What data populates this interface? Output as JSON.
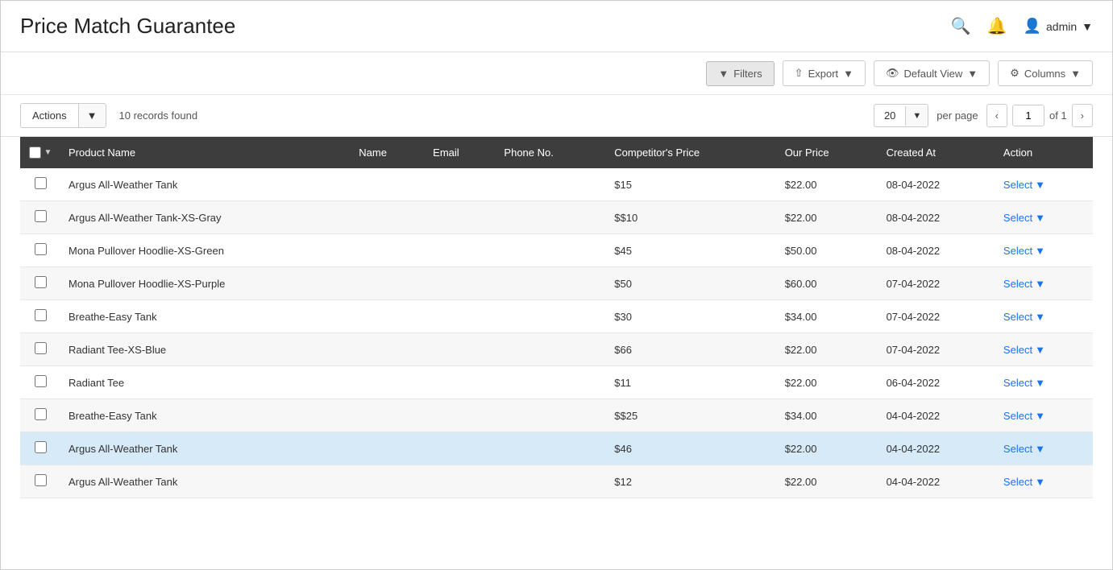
{
  "header": {
    "title": "Price Match Guarantee",
    "search_icon": "🔍",
    "bell_icon": "🔔",
    "user_label": "admin",
    "user_icon": "👤"
  },
  "toolbar": {
    "filters_label": "Filters",
    "export_label": "Export",
    "default_view_label": "Default View",
    "columns_label": "Columns"
  },
  "actions_bar": {
    "actions_label": "Actions",
    "records_found": "10 records found",
    "per_page_value": "20",
    "per_page_label": "per page",
    "page_current": "1",
    "page_total": "of 1"
  },
  "table": {
    "columns": [
      "",
      "Product Name",
      "Name",
      "Email",
      "Phone No.",
      "Competitor's Price",
      "Our Price",
      "Created At",
      "Action"
    ],
    "rows": [
      {
        "id": 1,
        "product_name": "Argus All-Weather Tank",
        "name": "",
        "email": "",
        "phone": "",
        "competitor_price": "$15",
        "our_price": "$22.00",
        "created_at": "08-04-2022",
        "highlighted": false
      },
      {
        "id": 2,
        "product_name": "Argus All-Weather Tank-XS-Gray",
        "name": "",
        "email": "",
        "phone": "",
        "competitor_price": "$$10",
        "our_price": "$22.00",
        "created_at": "08-04-2022",
        "highlighted": false
      },
      {
        "id": 3,
        "product_name": "Mona Pullover Hoodlie-XS-Green",
        "name": "",
        "email": "",
        "phone": "",
        "competitor_price": "$45",
        "our_price": "$50.00",
        "created_at": "08-04-2022",
        "highlighted": false
      },
      {
        "id": 4,
        "product_name": "Mona Pullover Hoodlie-XS-Purple",
        "name": "",
        "email": "",
        "phone": "",
        "competitor_price": "$50",
        "our_price": "$60.00",
        "created_at": "07-04-2022",
        "highlighted": false
      },
      {
        "id": 5,
        "product_name": "Breathe-Easy Tank",
        "name": "",
        "email": "",
        "phone": "",
        "competitor_price": "$30",
        "our_price": "$34.00",
        "created_at": "07-04-2022",
        "highlighted": false
      },
      {
        "id": 6,
        "product_name": "Radiant Tee-XS-Blue",
        "name": "",
        "email": "",
        "phone": "",
        "competitor_price": "$66",
        "our_price": "$22.00",
        "created_at": "07-04-2022",
        "highlighted": false
      },
      {
        "id": 7,
        "product_name": "Radiant Tee",
        "name": "",
        "email": "",
        "phone": "",
        "competitor_price": "$11",
        "our_price": "$22.00",
        "created_at": "06-04-2022",
        "highlighted": false
      },
      {
        "id": 8,
        "product_name": "Breathe-Easy Tank",
        "name": "",
        "email": "",
        "phone": "",
        "competitor_price": "$$25",
        "our_price": "$34.00",
        "created_at": "04-04-2022",
        "highlighted": false
      },
      {
        "id": 9,
        "product_name": "Argus All-Weather Tank",
        "name": "",
        "email": "",
        "phone": "",
        "competitor_price": "$46",
        "our_price": "$22.00",
        "created_at": "04-04-2022",
        "highlighted": true
      },
      {
        "id": 10,
        "product_name": "Argus All-Weather Tank",
        "name": "",
        "email": "",
        "phone": "",
        "competitor_price": "$12",
        "our_price": "$22.00",
        "created_at": "04-04-2022",
        "highlighted": false
      }
    ],
    "action_label": "Select"
  }
}
